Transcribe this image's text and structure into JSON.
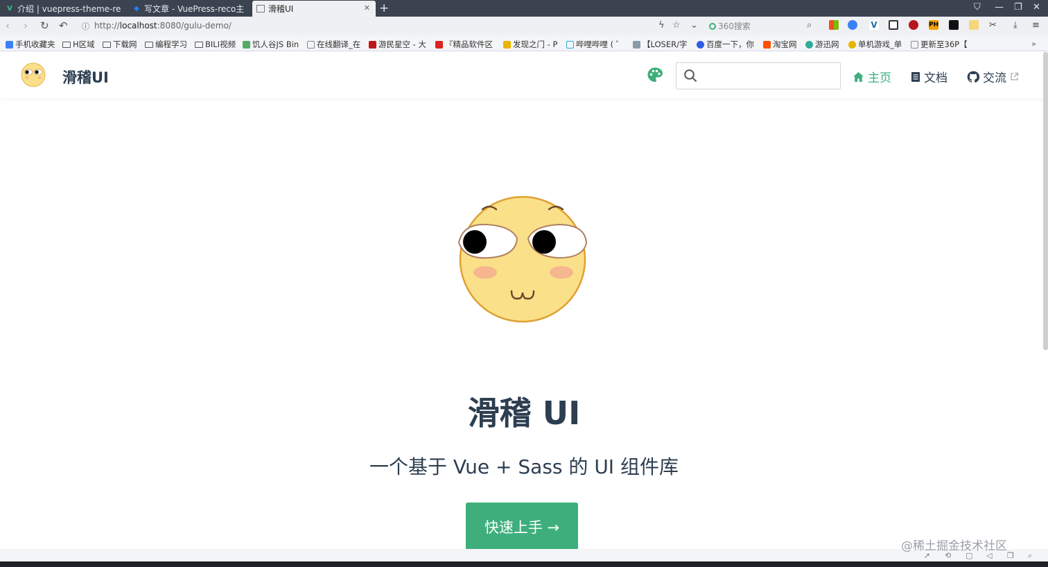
{
  "browser": {
    "tabs": [
      {
        "title": "介绍 | vuepress-theme-re",
        "active": false,
        "icon": "vue-favicon"
      },
      {
        "title": "写文章 - VuePress-reco主",
        "active": false,
        "icon": "juejin-favicon"
      },
      {
        "title": "滑稽UI",
        "active": true,
        "icon": "page-favicon"
      }
    ],
    "new_tab": "+",
    "url_prefix": "http://",
    "url_host": "localhost",
    "url_rest": ":8080/gulu-demo/",
    "search_engine": "360搜索"
  },
  "bookmarks": [
    "手机收藏夹",
    "H区域",
    "下载网",
    "编程学习",
    "BILI视频",
    "饥人谷JS Bin",
    "在线翻译_在",
    "游民星空 - 大",
    "『精品软件区",
    "发现之门 - P",
    "哔哩哔哩 ( ゜",
    "【LOSER/字",
    "百度一下，你",
    "淘宝网",
    "游迅网",
    "单机游戏_单",
    "更新至36P【"
  ],
  "navbar": {
    "site_title": "滑稽UI",
    "search_value": "",
    "links": [
      {
        "label": "主页",
        "icon": "home-icon",
        "active": true
      },
      {
        "label": "文档",
        "icon": "doc-icon",
        "active": false
      },
      {
        "label": "交流",
        "icon": "github-icon",
        "active": false
      }
    ]
  },
  "hero": {
    "title": "滑稽 UI",
    "description": "一个基于 Vue + Sass 的 UI 组件库",
    "action": "快速上手 →"
  },
  "watermark": "@稀土掘金技术社区",
  "colors": {
    "accent": "#3eaf7c",
    "text": "#2c3e50",
    "face": "#fbe08a"
  }
}
